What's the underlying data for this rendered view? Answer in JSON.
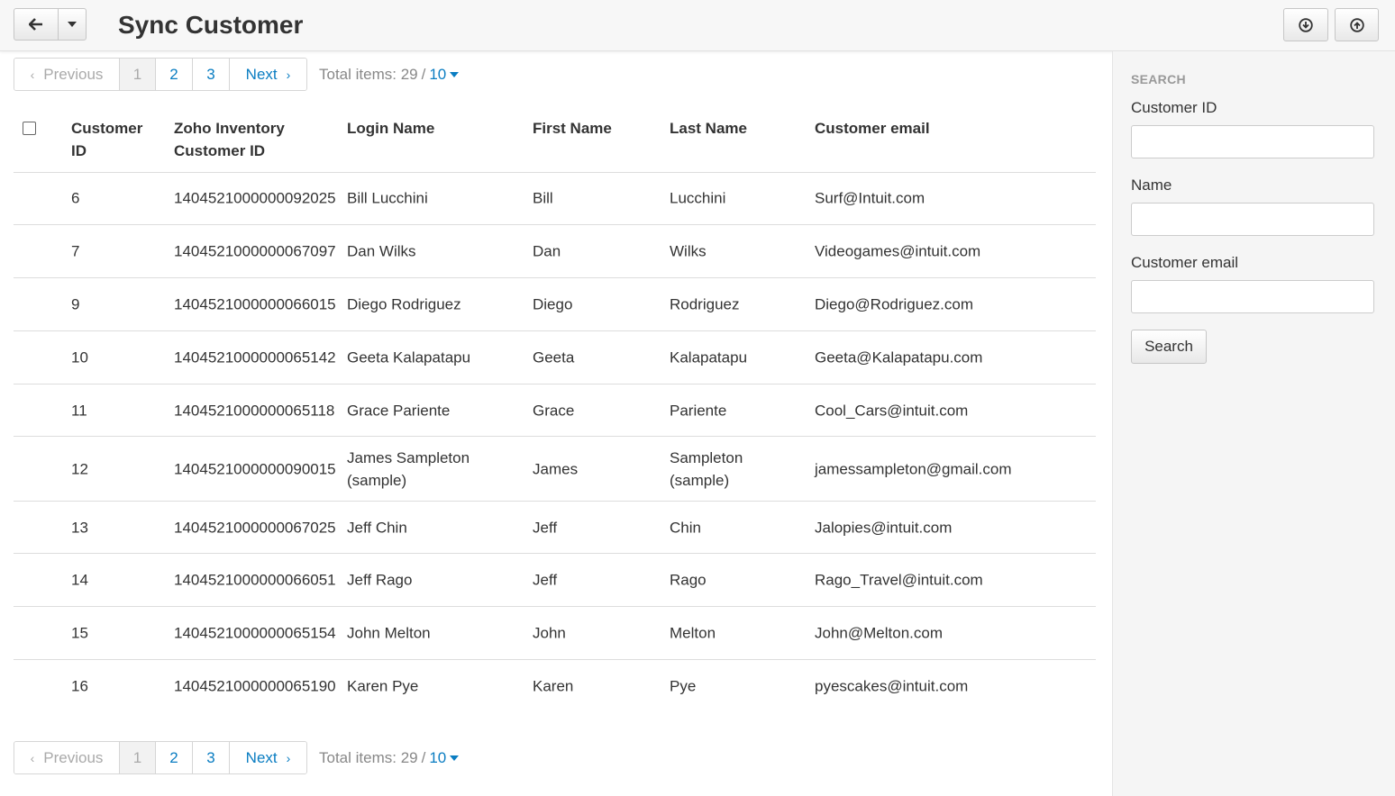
{
  "header": {
    "title": "Sync Customer",
    "back_icon": "arrow-left-icon",
    "caret_icon": "caret-down-icon",
    "download_icon": "circle-arrow-down-icon",
    "upload_icon": "circle-arrow-up-icon"
  },
  "pagination": {
    "previous": "Previous",
    "pages": [
      "1",
      "2",
      "3"
    ],
    "current_page": "1",
    "next": "Next",
    "total_label": "Total items: 29",
    "separator": "/",
    "per_page": "10"
  },
  "table": {
    "columns": {
      "customer_id": "Customer ID",
      "zoho_id": "Zoho Inventory Customer ID",
      "login": "Login Name",
      "first": "First Name",
      "last": "Last Name",
      "email": "Customer email"
    },
    "rows": [
      {
        "id": "6",
        "zoho": "1404521000000092025",
        "login": "Bill Lucchini",
        "first": "Bill",
        "last": "Lucchini",
        "email": "Surf@Intuit.com"
      },
      {
        "id": "7",
        "zoho": "1404521000000067097",
        "login": "Dan Wilks",
        "first": "Dan",
        "last": "Wilks",
        "email": "Videogames@intuit.com"
      },
      {
        "id": "9",
        "zoho": "1404521000000066015",
        "login": "Diego Rodriguez",
        "first": "Diego",
        "last": "Rodriguez",
        "email": "Diego@Rodriguez.com"
      },
      {
        "id": "10",
        "zoho": "1404521000000065142",
        "login": "Geeta Kalapatapu",
        "first": "Geeta",
        "last": "Kalapatapu",
        "email": "Geeta@Kalapatapu.com"
      },
      {
        "id": "11",
        "zoho": "1404521000000065118",
        "login": "Grace Pariente",
        "first": "Grace",
        "last": "Pariente",
        "email": "Cool_Cars@intuit.com"
      },
      {
        "id": "12",
        "zoho": "1404521000000090015",
        "login": "James Sampleton (sample)",
        "first": "James",
        "last": "Sampleton (sample)",
        "email": "jamessampleton@gmail.com"
      },
      {
        "id": "13",
        "zoho": "1404521000000067025",
        "login": "Jeff Chin",
        "first": "Jeff",
        "last": "Chin",
        "email": "Jalopies@intuit.com"
      },
      {
        "id": "14",
        "zoho": "1404521000000066051",
        "login": "Jeff Rago",
        "first": "Jeff",
        "last": "Rago",
        "email": "Rago_Travel@intuit.com"
      },
      {
        "id": "15",
        "zoho": "1404521000000065154",
        "login": "John Melton",
        "first": "John",
        "last": "Melton",
        "email": "John@Melton.com"
      },
      {
        "id": "16",
        "zoho": "1404521000000065190",
        "login": "Karen Pye",
        "first": "Karen",
        "last": "Pye",
        "email": "pyescakes@intuit.com"
      }
    ]
  },
  "sidebar": {
    "heading": "SEARCH",
    "customer_id_label": "Customer ID",
    "customer_id_value": "",
    "name_label": "Name",
    "name_value": "",
    "email_label": "Customer email",
    "email_value": "",
    "search_button": "Search"
  }
}
